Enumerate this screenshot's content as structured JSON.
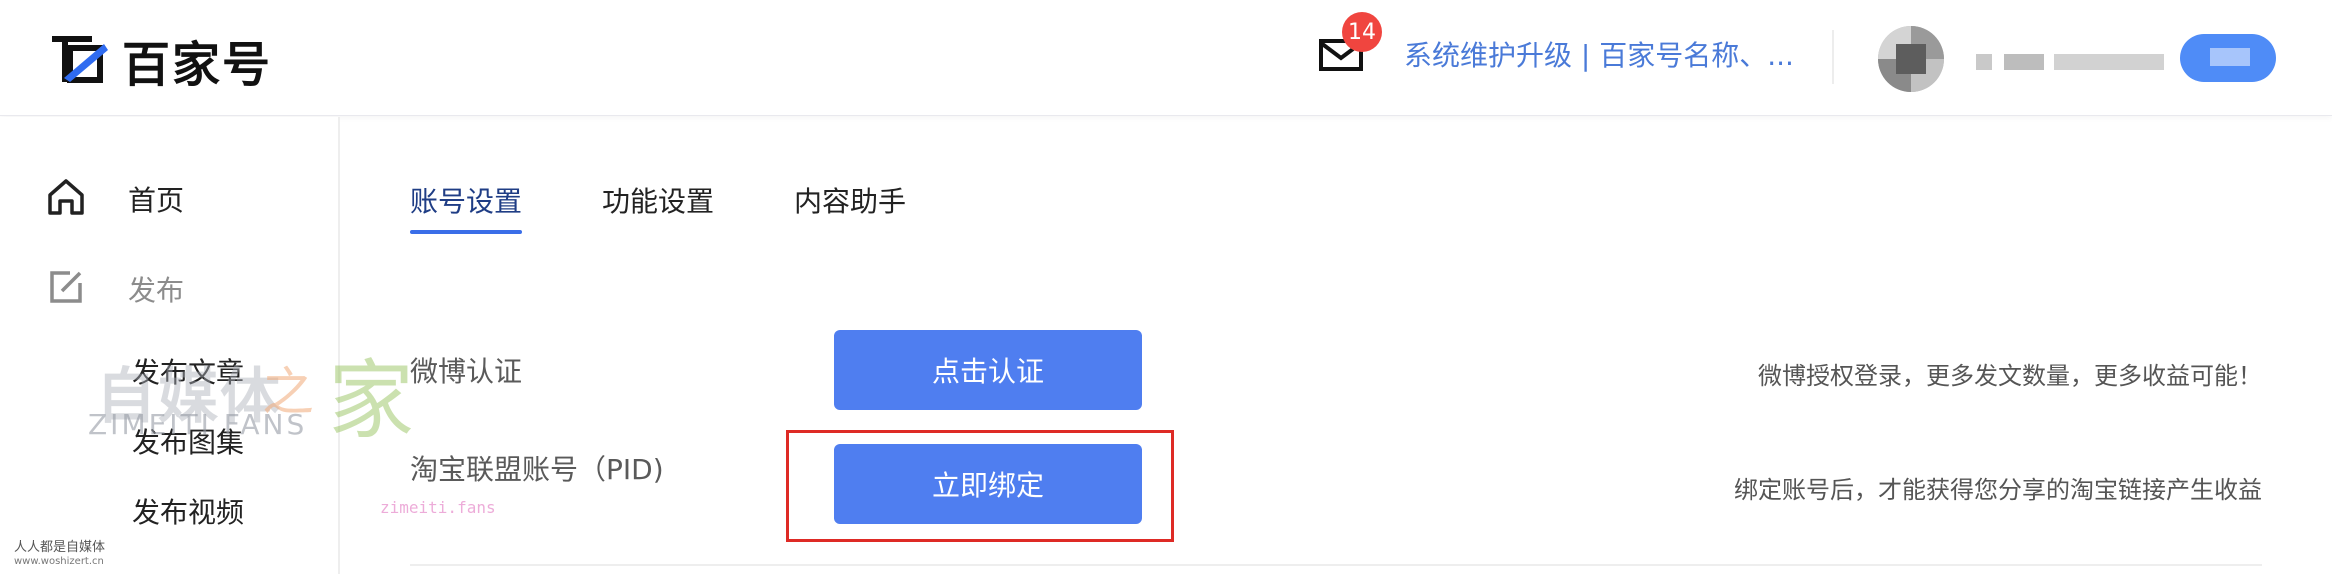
{
  "header": {
    "logo_text": "百家号",
    "notification_count": "14",
    "notice_text": "系统维护升级 | 百家号名称、..."
  },
  "sidebar": {
    "items": [
      {
        "label": "首页",
        "icon": "home-icon"
      },
      {
        "label": "发布",
        "icon": "edit-icon"
      }
    ],
    "sub_items": [
      "发布文章",
      "发布图集",
      "发布视频"
    ]
  },
  "watermark": {
    "brand": "自媒体",
    "zhi": "之",
    "jia": "家",
    "english": "ZIMEITI FANS",
    "small": "zimeiti.fans",
    "footer_line1": "人人都是自媒体",
    "footer_line2": "www.woshizert.cn"
  },
  "tabs": [
    {
      "label": "账号设置",
      "active": true
    },
    {
      "label": "功能设置",
      "active": false
    },
    {
      "label": "内容助手",
      "active": false
    }
  ],
  "settings": [
    {
      "label": "微博认证",
      "button": "点击认证",
      "description": "微博授权登录，更多发文数量，更多收益可能！"
    },
    {
      "label": "淘宝联盟账号（PID)",
      "button": "立即绑定",
      "description": "绑定账号后，才能获得您分享的淘宝链接产生收益"
    }
  ],
  "colors": {
    "accent": "#4f7ef0",
    "notice_link": "#4a7ad8",
    "badge": "#f0453f",
    "highlight": "#de2a25"
  }
}
